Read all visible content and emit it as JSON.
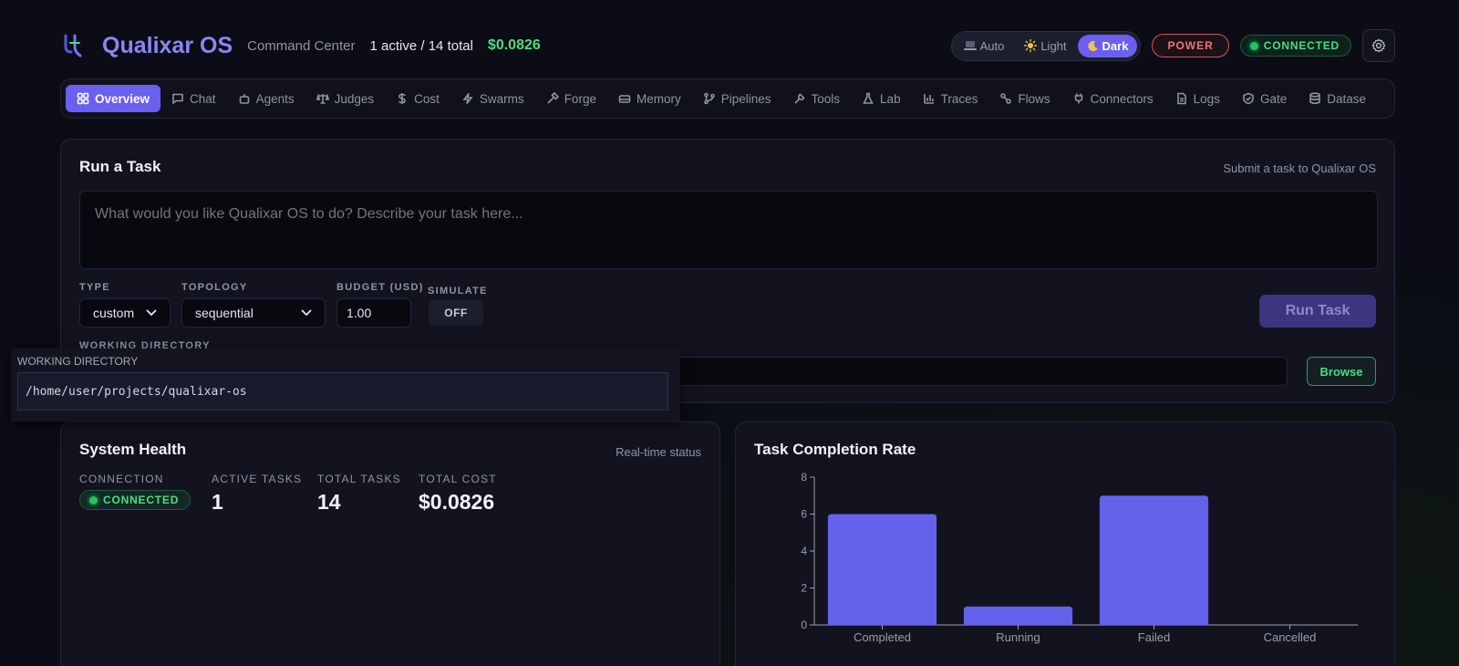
{
  "header": {
    "brand": "Qualixar OS",
    "subtitle": "Command Center",
    "counts": "1 active / 14 total",
    "cost": "$0.0826",
    "theme": [
      {
        "label": "Auto",
        "icon": "laptop-icon",
        "active": false
      },
      {
        "label": "Light",
        "icon": "sun-icon",
        "active": false
      },
      {
        "label": "Dark",
        "icon": "moon-icon",
        "active": true
      }
    ],
    "power_label": "POWER",
    "connection_label": "CONNECTED"
  },
  "tabs": [
    {
      "label": "Overview",
      "icon": "grid-icon",
      "active": true
    },
    {
      "label": "Chat",
      "icon": "chat-icon"
    },
    {
      "label": "Agents",
      "icon": "robot-icon"
    },
    {
      "label": "Judges",
      "icon": "scale-icon"
    },
    {
      "label": "Cost",
      "icon": "dollar-icon"
    },
    {
      "label": "Swarms",
      "icon": "bolt-icon"
    },
    {
      "label": "Forge",
      "icon": "hammer-icon"
    },
    {
      "label": "Memory",
      "icon": "drive-icon"
    },
    {
      "label": "Pipelines",
      "icon": "branch-icon"
    },
    {
      "label": "Tools",
      "icon": "wrench-icon"
    },
    {
      "label": "Lab",
      "icon": "flask-icon"
    },
    {
      "label": "Traces",
      "icon": "bars-icon"
    },
    {
      "label": "Flows",
      "icon": "flow-icon"
    },
    {
      "label": "Connectors",
      "icon": "plug-icon"
    },
    {
      "label": "Logs",
      "icon": "file-icon"
    },
    {
      "label": "Gate",
      "icon": "shield-icon"
    },
    {
      "label": "Datase",
      "icon": "database-icon"
    }
  ],
  "task": {
    "title": "Run a Task",
    "hint": "Submit a task to Qualixar OS",
    "placeholder": "What would you like Qualixar OS to do? Describe your task here...",
    "type_label": "TYPE",
    "type_value": "custom",
    "topology_label": "TOPOLOGY",
    "topology_value": "sequential",
    "budget_label": "BUDGET (USD)",
    "budget_value": "1.00",
    "simulate_label": "SIMULATE",
    "simulate_value": "OFF",
    "run_label": "Run Task",
    "workdir_label": "WORKING DIRECTORY",
    "browse_label": "Browse"
  },
  "overlay": {
    "label": "WORKING DIRECTORY",
    "value": "/home/user/projects/qualixar-os"
  },
  "health": {
    "title": "System Health",
    "hint": "Real-time status",
    "connection_label": "CONNECTION",
    "connection_value": "CONNECTED",
    "active_label": "ACTIVE TASKS",
    "active_value": "1",
    "total_label": "TOTAL TASKS",
    "total_value": "14",
    "cost_label": "TOTAL COST",
    "cost_value": "$0.0826"
  },
  "colors": {
    "accent": "#6b5ff0",
    "bar": "#6461eb",
    "success": "#4ade80",
    "danger": "#f87171"
  },
  "chart_data": {
    "type": "bar",
    "title": "Task Completion Rate",
    "categories": [
      "Completed",
      "Running",
      "Failed",
      "Cancelled"
    ],
    "values": [
      6,
      1,
      7,
      0
    ],
    "ylim": [
      0,
      8
    ],
    "yticks": [
      0,
      2,
      4,
      6,
      8
    ],
    "xlabel": "",
    "ylabel": "",
    "grid": false
  }
}
